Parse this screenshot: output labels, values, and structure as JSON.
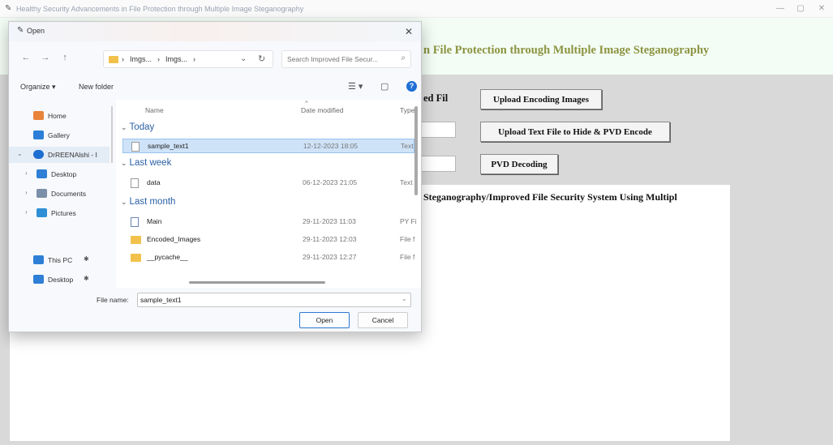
{
  "window": {
    "title": "Healthy Security Advancements in File Protection through Multiple Image Steganography",
    "minimize": "—",
    "maximize": "▢",
    "close": "✕"
  },
  "app": {
    "heading": "n File Protection through Multiple Image Steganography",
    "encrypted_label": "ed Fil",
    "upload_images_button": "Upload Encoding Images",
    "upload_text_button": "Upload Text File to Hide & PVD Encode",
    "pvd_decoding_button": "PVD Decoding",
    "output_text": "Steganography/Improved File Security System Using Multipl"
  },
  "dialog": {
    "title": "Open",
    "close": "✕",
    "nav": {
      "back": "←",
      "forward": "→",
      "up": "↑"
    },
    "address": {
      "segments": [
        "›",
        "Imgs...",
        "›",
        "Imgs...",
        "›"
      ],
      "dropdown": "⌄",
      "refresh": "↻"
    },
    "search_placeholder": "Search Improved File Secur...",
    "search_icon": "⌕",
    "organize": "Organize ▾",
    "new_folder": "New folder",
    "view_icon": "☰ ▾",
    "pane_icon": "▢",
    "help_icon": "?",
    "nav_pane": [
      {
        "label": "Home",
        "icon": "home-icon",
        "color": "#e8833a"
      },
      {
        "label": "Gallery",
        "icon": "gallery-icon",
        "color": "#2b7fd8"
      },
      {
        "label": "DrREENAlshi - I",
        "icon": "onedrive-icon",
        "color": "#1d6fd1",
        "chevron": "⌄",
        "selected": true
      },
      {
        "label": "Desktop",
        "icon": "desktop-icon",
        "color": "#2f7fd6",
        "chevron": "›"
      },
      {
        "label": "Documents",
        "icon": "documents-icon",
        "color": "#7b8fa8",
        "chevron": "›"
      },
      {
        "label": "Pictures",
        "icon": "pictures-icon",
        "color": "#2f8fd6",
        "chevron": "›"
      },
      {
        "label": "This PC",
        "icon": "pc-icon",
        "color": "#2f7fd6",
        "pin": "✱"
      },
      {
        "label": "Desktop",
        "icon": "desktop-icon",
        "color": "#2f7fd6",
        "pin": "✱"
      }
    ],
    "columns": {
      "name": "Name",
      "date": "Date modified",
      "type": "Type",
      "sort": "^"
    },
    "groups": [
      {
        "label": "Today",
        "chevron": "⌄"
      },
      {
        "label": "Last week",
        "chevron": "⌄"
      },
      {
        "label": "Last month",
        "chevron": "⌄"
      }
    ],
    "files": [
      {
        "name": "sample_text1",
        "date": "12-12-2023 18:05",
        "type": "Text",
        "icon": "text-file-icon",
        "selected": true
      },
      {
        "name": "data",
        "date": "06-12-2023 21:05",
        "type": "Text",
        "icon": "text-file-icon"
      },
      {
        "name": "Main",
        "date": "29-11-2023 11:03",
        "type": "PY Fi",
        "icon": "python-file-icon"
      },
      {
        "name": "Encoded_Images",
        "date": "29-11-2023 12:03",
        "type": "File f",
        "icon": "folder-icon"
      },
      {
        "name": "__pycache__",
        "date": "29-11-2023 12:27",
        "type": "File f",
        "icon": "folder-icon"
      }
    ],
    "file_name_label": "File name:",
    "file_name_value": "sample_text1",
    "open_button": "Open",
    "cancel_button": "Cancel"
  },
  "colors": {
    "heading": "#8c9340",
    "header_bg": "#f3fdf5",
    "client_bg": "#d9d9d9",
    "selection": "#cfe3f8",
    "group_header": "#2a5fa5",
    "accent": "#1f6fd6"
  }
}
